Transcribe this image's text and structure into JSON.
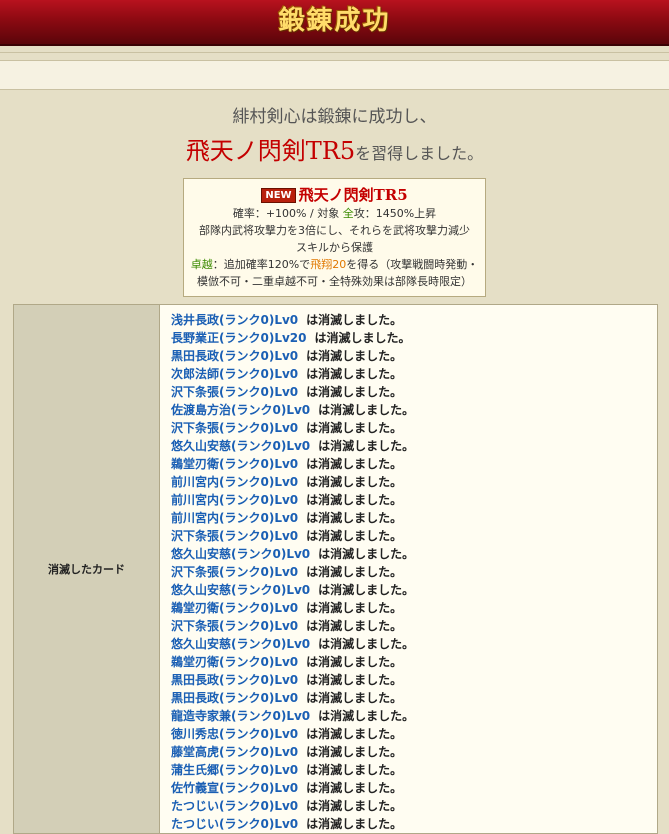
{
  "header": {
    "title": "鍛錬成功"
  },
  "message": {
    "line1": "緋村剣心は鍛錬に成功し、",
    "skill_name": "飛天ノ閃剣TR5",
    "line2_suffix": "を習得しました。"
  },
  "skill_card": {
    "badge": "NEW",
    "name": "飛天ノ閃剣TR5",
    "stats_prefix": "確率：+100% / 対象 ",
    "stats_target": "全",
    "stats_suffix": "攻：1450%上昇",
    "desc1": "部隊内武将攻撃力を3倍にし、それらを武将攻撃力減少",
    "desc2": "スキルから保護",
    "ext_label": "卓越",
    "ext_mid": "：追加確率120%で",
    "ext_skill": "飛翔20",
    "ext_suffix": "を得る（攻撃戦闘時発動・",
    "ext_line2": "模倣不可・二重卓越不可・全特殊効果は部隊長時限定）"
  },
  "colors": {
    "header_red": "#8c0a12",
    "gold_text": "#ffdc6a",
    "link_blue": "#1a5fb4",
    "skill_red": "#c40000"
  },
  "consumed": {
    "label": "消滅したカード",
    "suffix": "は消滅しました。",
    "items": [
      "浅井長政(ランク0)Lv0",
      "長野業正(ランク0)Lv20",
      "黒田長政(ランク0)Lv0",
      "次郎法師(ランク0)Lv0",
      "沢下条張(ランク0)Lv0",
      "佐渡島方治(ランク0)Lv0",
      "沢下条張(ランク0)Lv0",
      "悠久山安慈(ランク0)Lv0",
      "鵜堂刃衛(ランク0)Lv0",
      "前川宮内(ランク0)Lv0",
      "前川宮内(ランク0)Lv0",
      "前川宮内(ランク0)Lv0",
      "沢下条張(ランク0)Lv0",
      "悠久山安慈(ランク0)Lv0",
      "沢下条張(ランク0)Lv0",
      "悠久山安慈(ランク0)Lv0",
      "鵜堂刃衛(ランク0)Lv0",
      "沢下条張(ランク0)Lv0",
      "悠久山安慈(ランク0)Lv0",
      "鵜堂刃衛(ランク0)Lv0",
      "黒田長政(ランク0)Lv0",
      "黒田長政(ランク0)Lv0",
      "龍造寺家兼(ランク0)Lv0",
      "徳川秀忠(ランク0)Lv0",
      "藤堂高虎(ランク0)Lv0",
      "蒲生氏郷(ランク0)Lv0",
      "佐竹義宣(ランク0)Lv0",
      "たつじい(ランク0)Lv0",
      "たつじい(ランク0)Lv0"
    ]
  }
}
